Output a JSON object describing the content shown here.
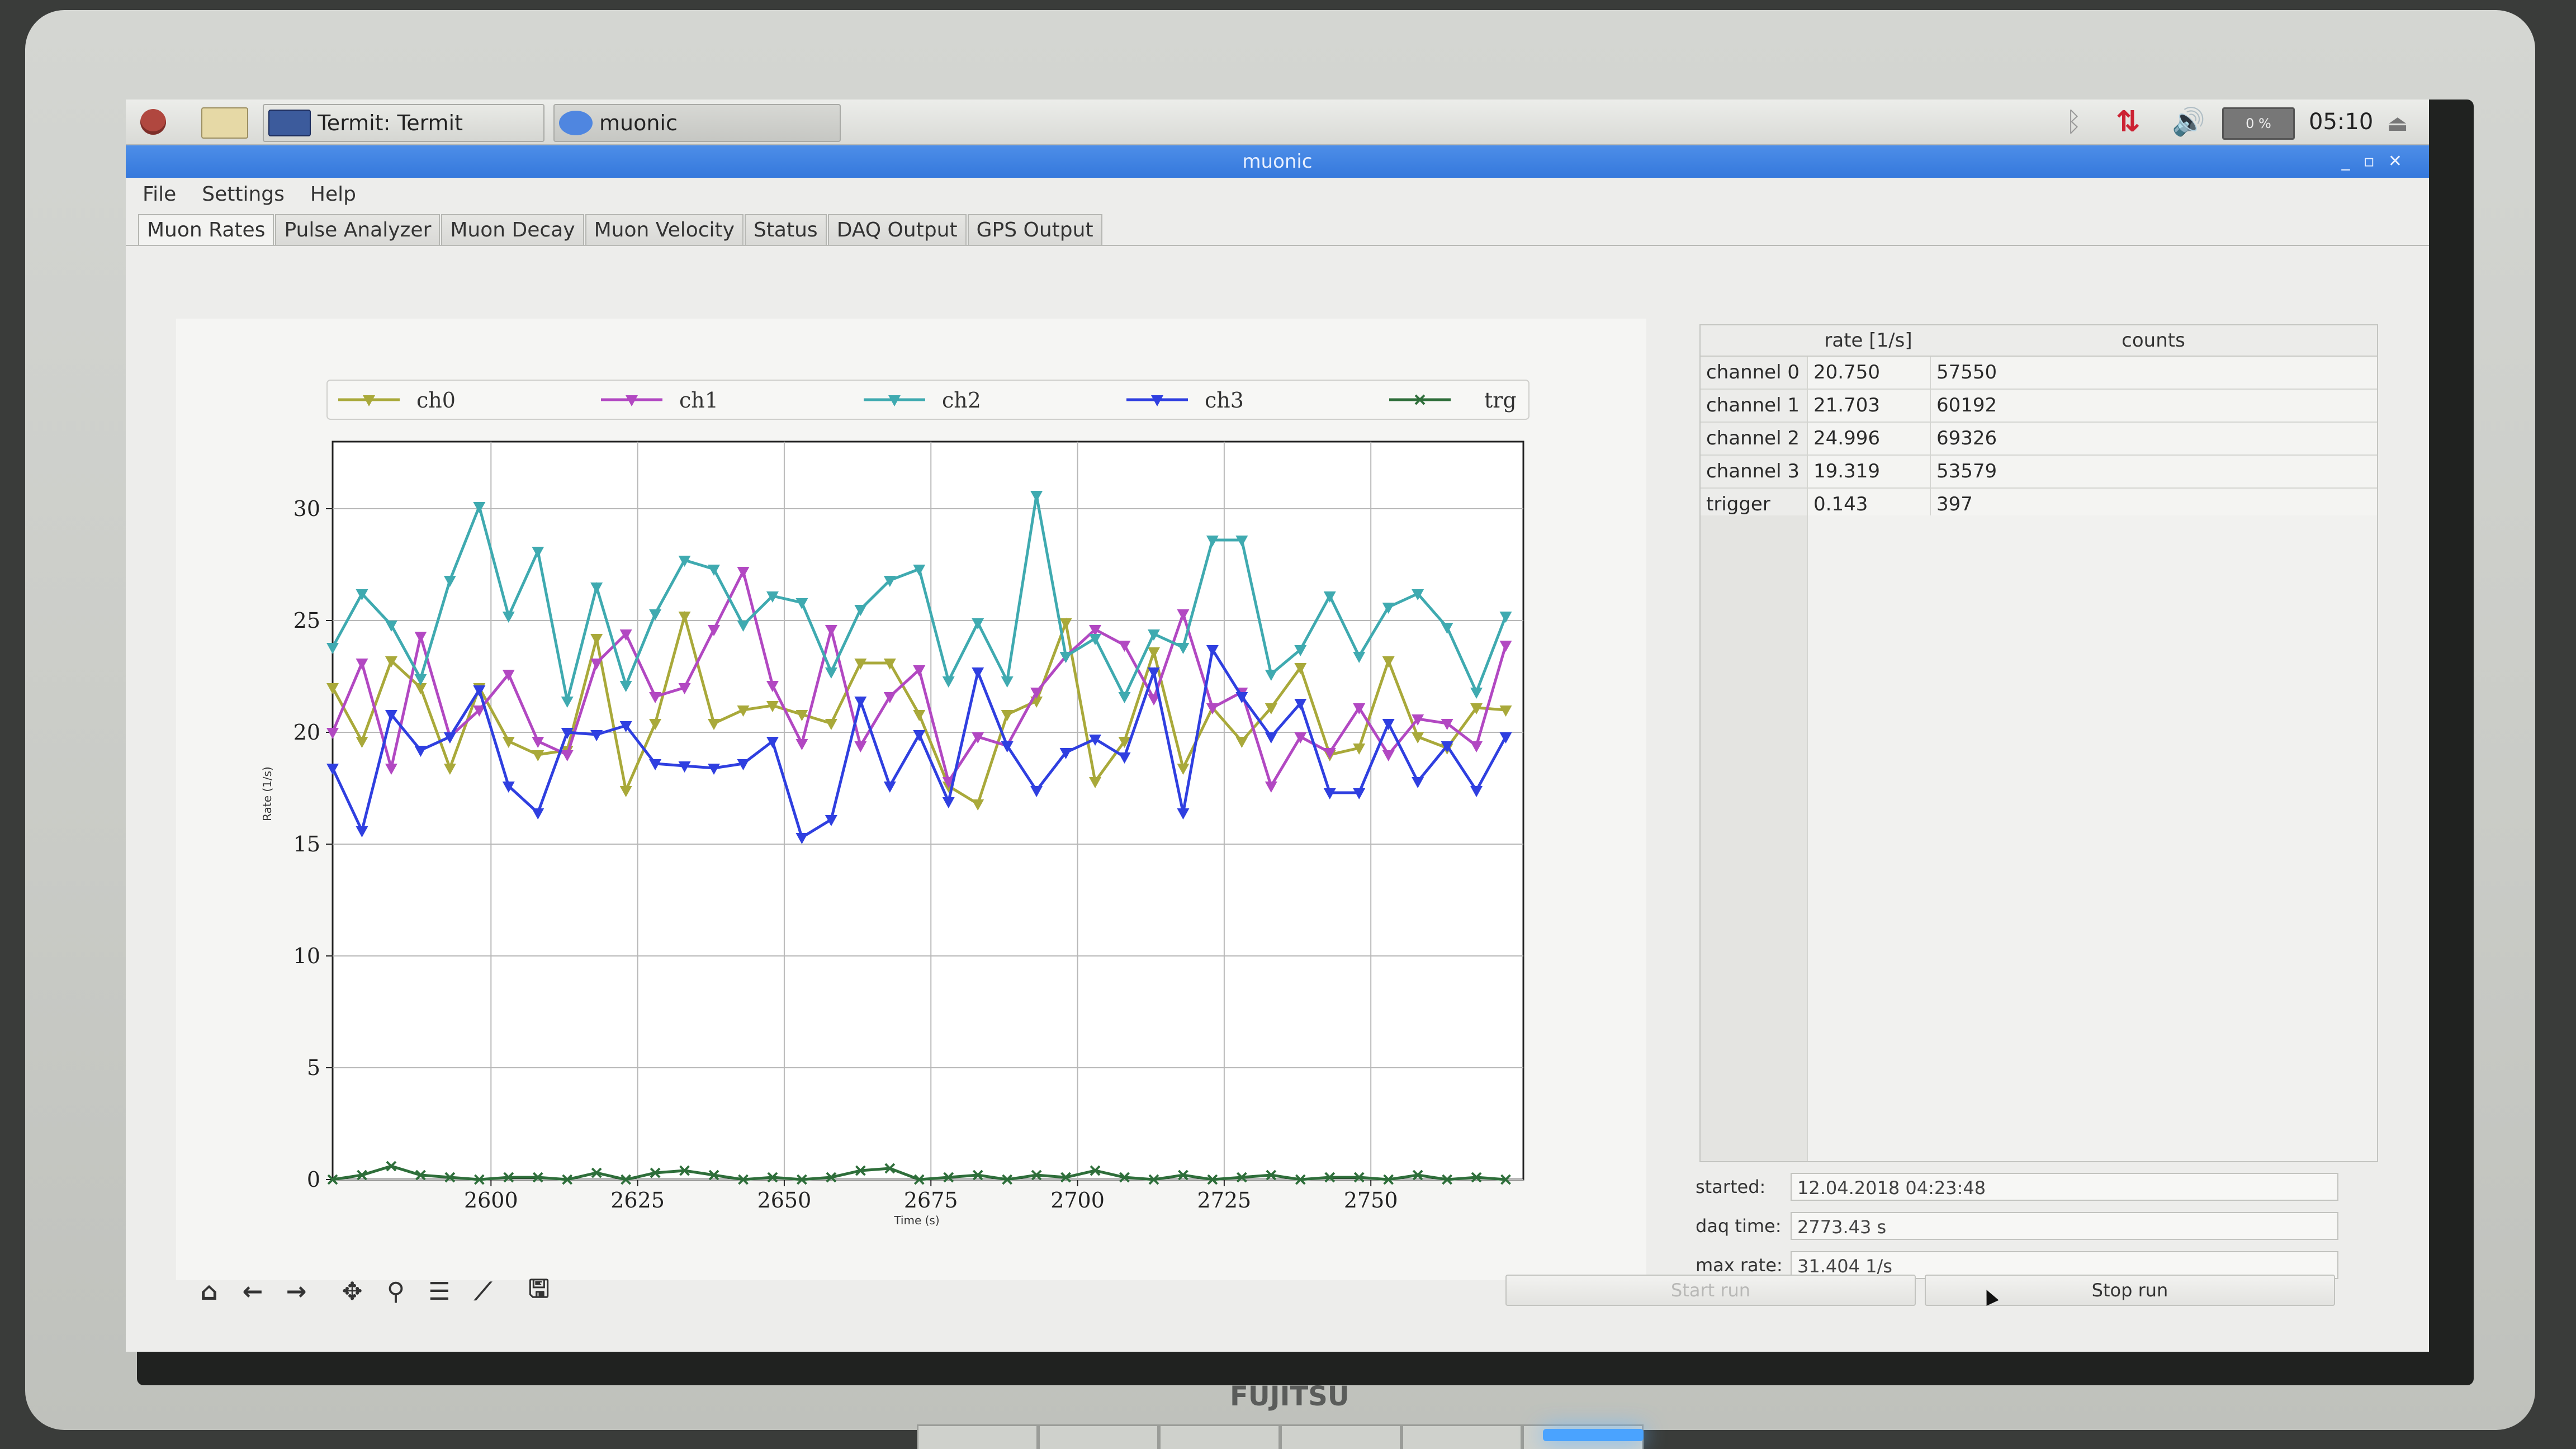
{
  "panel": {
    "tasks": [
      {
        "label": "Termit: Termit"
      },
      {
        "label": "muonic"
      }
    ],
    "clock": "05:10",
    "cpu_monitor": "0 %"
  },
  "window": {
    "title": "muonic",
    "menu": [
      "File",
      "Settings",
      "Help"
    ],
    "tabs": [
      "Muon Rates",
      "Pulse Analyzer",
      "Muon Decay",
      "Muon Velocity",
      "Status",
      "DAQ Output",
      "GPS Output"
    ],
    "active_tab": "Muon Rates"
  },
  "rates_table": {
    "headers": [
      "",
      "rate [1/s]",
      "counts"
    ],
    "rows": [
      {
        "name": "channel 0",
        "rate": "20.750",
        "counts": "57550"
      },
      {
        "name": "channel 1",
        "rate": "21.703",
        "counts": "60192"
      },
      {
        "name": "channel 2",
        "rate": "24.996",
        "counts": "69326"
      },
      {
        "name": "channel 3",
        "rate": "19.319",
        "counts": "53579"
      },
      {
        "name": "trigger",
        "rate": "0.143",
        "counts": "397"
      }
    ]
  },
  "info": {
    "started_label": "started:",
    "started_value": "12.04.2018 04:23:48",
    "daq_time_label": "daq time:",
    "daq_time_value": "2773.43 s",
    "max_rate_label": "max rate:",
    "max_rate_value": "31.404 1/s"
  },
  "buttons": {
    "start_run": "Start run",
    "stop_run": "Stop run"
  },
  "brand": "FUJITSU",
  "chart_data": {
    "type": "line",
    "xlabel": "Time (s)",
    "ylabel": "Rate (1/s)",
    "xlim": [
      2573,
      2776
    ],
    "ylim": [
      0,
      33
    ],
    "xticks": [
      2600,
      2625,
      2650,
      2675,
      2700,
      2725,
      2750
    ],
    "yticks": [
      0,
      5,
      10,
      15,
      20,
      25,
      30
    ],
    "grid": true,
    "legend_position": "top",
    "x": [
      2573,
      2578,
      2583,
      2588,
      2593,
      2598,
      2603,
      2608,
      2613,
      2618,
      2623,
      2628,
      2633,
      2638,
      2643,
      2648,
      2653,
      2658,
      2663,
      2668,
      2673,
      2678,
      2683,
      2688,
      2693,
      2698,
      2703,
      2708,
      2713,
      2718,
      2723,
      2728,
      2733,
      2738,
      2743,
      2748,
      2753,
      2758,
      2763,
      2768,
      2773
    ],
    "series": [
      {
        "name": "ch0",
        "color": "#a9a93a",
        "marker": "down-triangle",
        "values": [
          22,
          19.6,
          23.2,
          22,
          18.4,
          22,
          19.6,
          19,
          19.2,
          24.2,
          17.4,
          20.4,
          25.2,
          20.4,
          21,
          21.2,
          20.8,
          20.4,
          23.1,
          23.1,
          20.8,
          17.6,
          16.8,
          20.8,
          21.4,
          24.9,
          17.8,
          19.6,
          23.6,
          18.4,
          21.1,
          19.6,
          21.1,
          22.9,
          19,
          19.3,
          23.2,
          19.8,
          19.3,
          21.1,
          21
        ]
      },
      {
        "name": "ch1",
        "color": "#b248c2",
        "marker": "down-triangle",
        "values": [
          20,
          23.1,
          18.4,
          24.3,
          19.8,
          21,
          22.6,
          19.6,
          19,
          23.1,
          24.4,
          21.6,
          22,
          24.6,
          27.2,
          22.1,
          19.5,
          24.6,
          19.4,
          21.6,
          22.8,
          17.8,
          19.8,
          19.4,
          21.8,
          23.4,
          24.6,
          23.9,
          21.5,
          25.3,
          21.1,
          21.8,
          17.6,
          19.8,
          19.1,
          21.1,
          19,
          20.6,
          20.4,
          19.4,
          23.9
        ]
      },
      {
        "name": "ch2",
        "color": "#3faab0",
        "marker": "down-triangle",
        "values": [
          23.8,
          26.2,
          24.8,
          22.4,
          26.8,
          30.1,
          25.2,
          28.1,
          21.4,
          26.5,
          22.1,
          25.3,
          27.7,
          27.3,
          24.8,
          26.1,
          25.8,
          22.7,
          25.5,
          26.8,
          27.3,
          22.3,
          24.9,
          22.3,
          30.6,
          23.4,
          24.2,
          21.6,
          24.4,
          23.8,
          28.6,
          28.6,
          22.6,
          23.7,
          26.1,
          23.4,
          25.6,
          26.2,
          24.7,
          21.8,
          25.2
        ]
      },
      {
        "name": "ch3",
        "color": "#2f3fe0",
        "marker": "down-triangle",
        "values": [
          18.4,
          15.6,
          20.8,
          19.2,
          19.8,
          21.9,
          17.6,
          16.4,
          20,
          19.9,
          20.3,
          18.6,
          18.5,
          18.4,
          18.6,
          19.6,
          15.3,
          16.1,
          21.4,
          17.6,
          19.9,
          16.9,
          22.7,
          19.4,
          17.4,
          19.1,
          19.7,
          18.9,
          22.7,
          16.4,
          23.7,
          21.6,
          19.8,
          21.3,
          17.3,
          17.3,
          20.4,
          17.8,
          19.4,
          17.4,
          19.8
        ]
      },
      {
        "name": "trg",
        "color": "#2e6e3a",
        "marker": "x",
        "values": [
          0,
          0.2,
          0.6,
          0.2,
          0.1,
          0,
          0.1,
          0.1,
          0,
          0.3,
          0,
          0.3,
          0.4,
          0.2,
          0,
          0.1,
          0,
          0.1,
          0.4,
          0.5,
          0,
          0.1,
          0.2,
          0,
          0.2,
          0.1,
          0.4,
          0.1,
          0,
          0.2,
          0,
          0.1,
          0.2,
          0,
          0.1,
          0.1,
          0,
          0.2,
          0,
          0.1,
          0
        ]
      }
    ]
  }
}
